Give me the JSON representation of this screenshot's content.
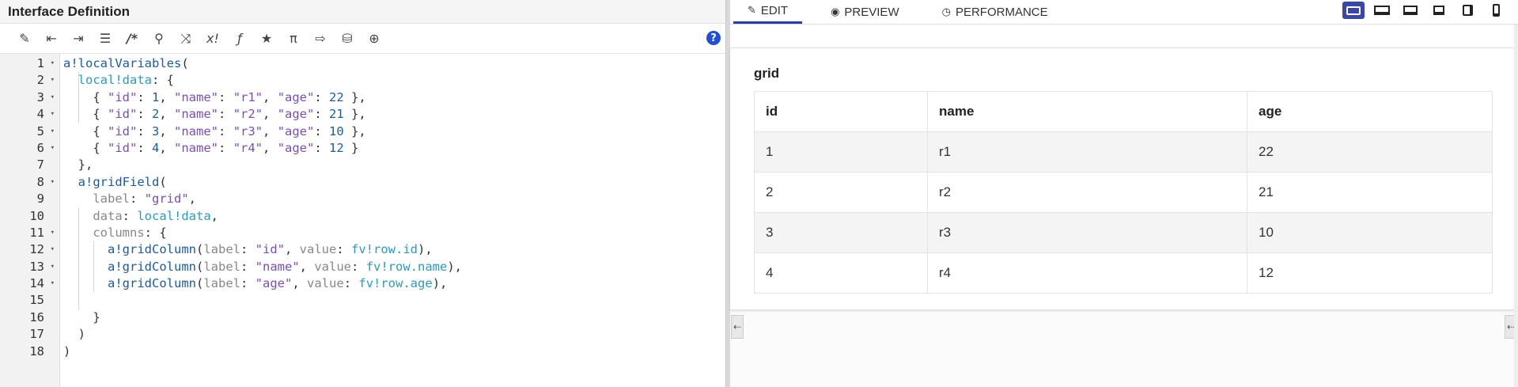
{
  "editor": {
    "title": "Interface Definition",
    "toolbar_icons": [
      "magic-wand-icon",
      "outdent-icon",
      "indent-icon",
      "list-icon",
      "comment-icon",
      "search-icon",
      "shuffle-icon",
      "superscript-icon",
      "function-icon",
      "star-icon",
      "pi-icon",
      "export-icon",
      "database-search-icon",
      "globe-icon"
    ],
    "help_label": "?",
    "line_numbers": [
      "1",
      "2",
      "3",
      "4",
      "5",
      "6",
      "7",
      "8",
      "9",
      "10",
      "11",
      "12",
      "13",
      "14",
      "15",
      "16",
      "17",
      "18"
    ]
  },
  "preview": {
    "tabs": [
      {
        "icon": "edit-icon",
        "label": "EDIT"
      },
      {
        "icon": "eye-icon",
        "label": "PREVIEW"
      },
      {
        "icon": "clock-icon",
        "label": "PERFORMANCE"
      }
    ],
    "grid_label": "grid",
    "columns": [
      "id",
      "name",
      "age"
    ],
    "rows": [
      [
        "1",
        "r1",
        "22"
      ],
      [
        "2",
        "r2",
        "21"
      ],
      [
        "3",
        "r3",
        "10"
      ],
      [
        "4",
        "r4",
        "12"
      ]
    ]
  },
  "colors": {
    "accent": "#2b3f9a",
    "function": "#1d5a9e",
    "variable": "#2a9bbf",
    "string": "#7a4fb3"
  }
}
